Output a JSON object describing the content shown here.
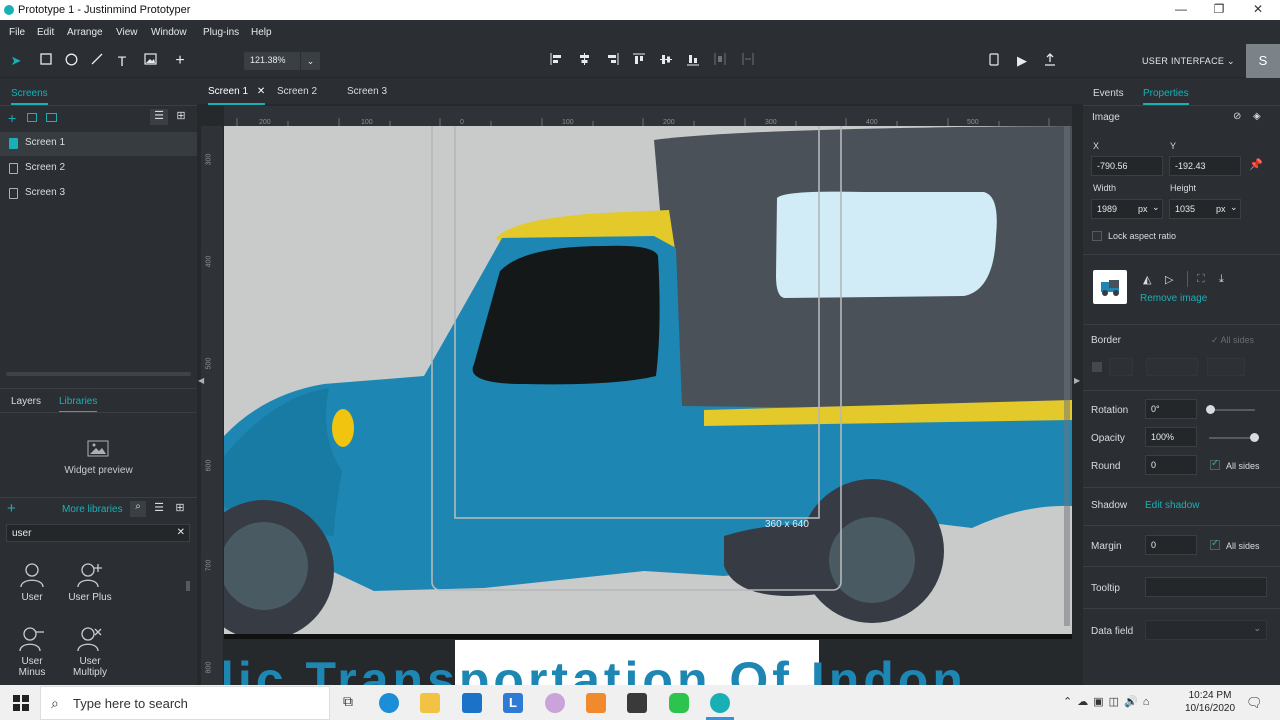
{
  "window": {
    "title": "Prototype 1 - Justinmind Prototyper",
    "minimize": "—",
    "maximize": "❐",
    "close": "✕"
  },
  "menu": [
    "File",
    "Edit",
    "Arrange",
    "View",
    "Window",
    "Plug-ins",
    "Help"
  ],
  "toolbar": {
    "zoom": "121.38%",
    "mode": "USER INTERFACE",
    "avatar": "S"
  },
  "left_panel": {
    "tabs": {
      "screens": "Screens"
    },
    "screens": [
      "Screen 1",
      "Screen 2",
      "Screen 3"
    ],
    "bottom_tabs": {
      "layers": "Layers",
      "libraries": "Libraries"
    },
    "widget_preview": "Widget preview",
    "more_libraries": "More libraries",
    "search_value": "user",
    "library_items": [
      "User",
      "User Plus",
      "User Minus",
      "User Multiply"
    ]
  },
  "screen_tabs": [
    "Screen 1",
    "Screen 2",
    "Screen 3"
  ],
  "ruler": {
    "top": [
      "200",
      "100",
      "0",
      "100",
      "200",
      "300",
      "400",
      "500"
    ],
    "left": [
      "300",
      "400",
      "500",
      "600",
      "700",
      "800"
    ]
  },
  "canvas": {
    "device_size": "360 x 640",
    "bottom_text": "lic Transportation Of Indon"
  },
  "right_panel": {
    "tabs": {
      "events": "Events",
      "properties": "Properties"
    },
    "element_type": "Image",
    "x_label": "X",
    "y_label": "Y",
    "x": "-790.56",
    "y": "-192.43",
    "width_label": "Width",
    "height_label": "Height",
    "width": "1989",
    "height": "1035",
    "unit_w": "px",
    "unit_h": "px",
    "lock_aspect": "Lock aspect ratio",
    "remove_image": "Remove image",
    "border_label": "Border",
    "all_sides_border": "All sides",
    "rotation_label": "Rotation",
    "rotation": "0°",
    "opacity_label": "Opacity",
    "opacity": "100%",
    "opacity_level": 1.0,
    "round_label": "Round",
    "round": "0",
    "round_all_sides": "All sides",
    "shadow_label": "Shadow",
    "edit_shadow": "Edit shadow",
    "margin_label": "Margin",
    "margin": "0",
    "margin_all_sides": "All sides",
    "tooltip_label": "Tooltip",
    "datafield_label": "Data field"
  },
  "taskbar": {
    "search_placeholder": "Type here to search",
    "time": "10:24 PM",
    "date": "10/16/2020"
  },
  "colors": {
    "accent": "#19b0b5",
    "panel": "#2b2f33",
    "truck_blue": "#1e86b3",
    "truck_yellow": "#e3c92a",
    "truck_dark": "#4b5159"
  }
}
